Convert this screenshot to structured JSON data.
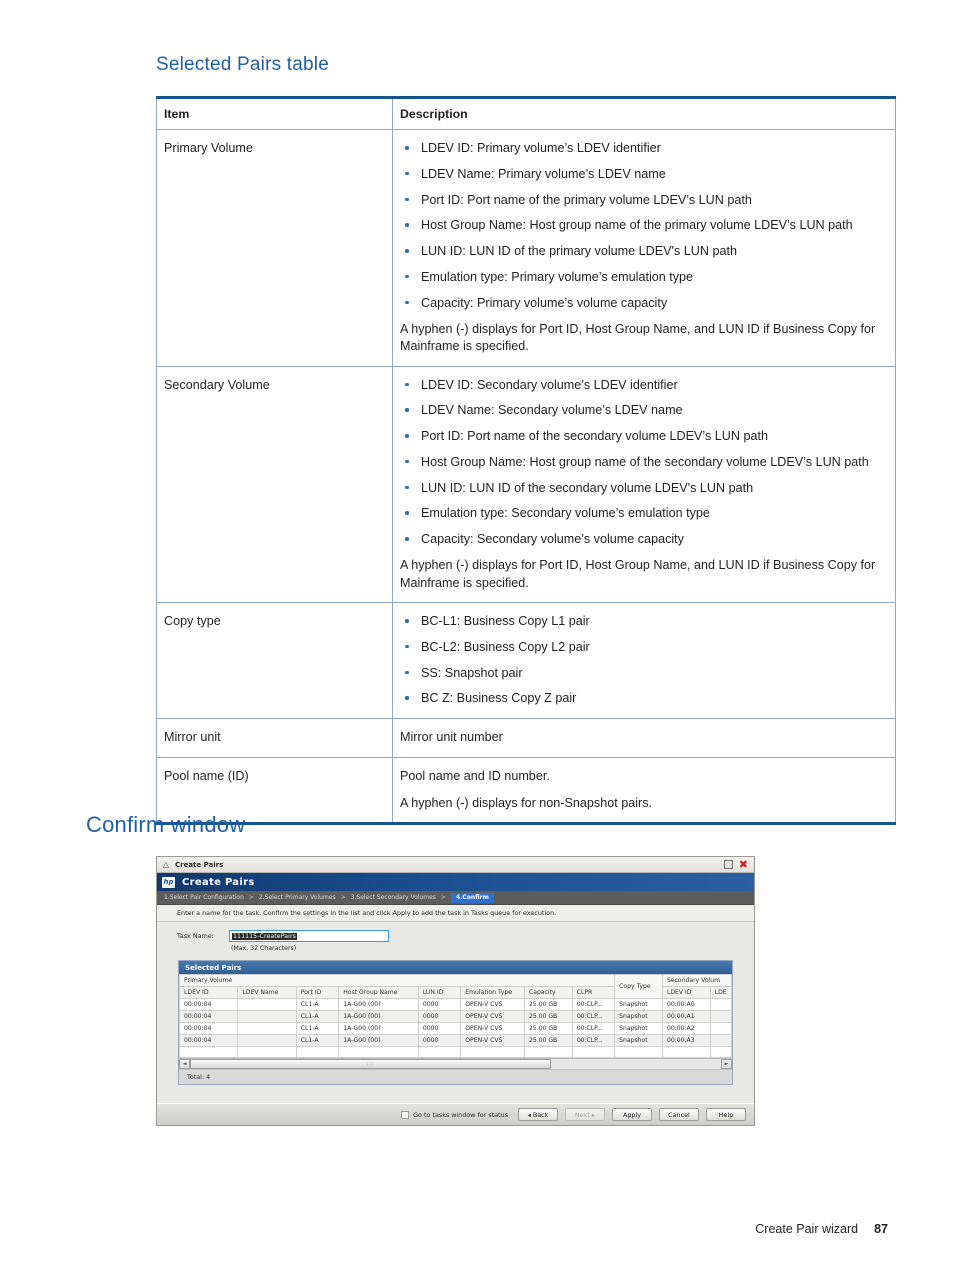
{
  "sections": {
    "selected_pairs_table_heading": "Selected Pairs table",
    "confirm_window_heading": "Confirm window"
  },
  "doc_table": {
    "headers": {
      "item": "Item",
      "description": "Description"
    },
    "rows": [
      {
        "item": "Primary Volume",
        "bullets": [
          "LDEV ID: Primary volume’s LDEV identifier",
          "LDEV Name: Primary volume’s LDEV name",
          "Port ID: Port name of the primary volume LDEV’s LUN path",
          "Host Group Name: Host group name of the primary volume LDEV’s LUN path",
          "LUN ID: LUN ID of the primary volume LDEV's LUN path",
          "Emulation type: Primary volume’s emulation type",
          "Capacity: Primary volume’s volume capacity"
        ],
        "note": "A hyphen (-) displays for Port ID, Host Group Name, and LUN ID if Business Copy for Mainframe is specified."
      },
      {
        "item": "Secondary Volume",
        "bullets": [
          "LDEV ID: Secondary volume’s LDEV identifier",
          "LDEV Name: Secondary volume’s LDEV name",
          "Port ID: Port name of the secondary volume LDEV’s LUN path",
          "Host Group Name: Host group name of the secondary volume LDEV’s LUN path",
          "LUN ID: LUN ID of the secondary volume LDEV's LUN path",
          "Emulation type: Secondary volume’s emulation type",
          "Capacity: Secondary volume’s volume capacity"
        ],
        "note": "A hyphen (-) displays for Port ID, Host Group Name, and LUN ID if Business Copy for Mainframe is specified."
      },
      {
        "item": "Copy type",
        "bullets": [
          "BC-L1: Business Copy L1 pair",
          "BC-L2: Business Copy L2 pair",
          "SS: Snapshot pair",
          "BC Z: Business Copy Z pair"
        ],
        "note": ""
      },
      {
        "item": "Mirror unit",
        "bullets": [],
        "paras": [
          "Mirror unit number"
        ]
      },
      {
        "item": "Pool name (ID)",
        "bullets": [],
        "paras": [
          "Pool name and ID number.",
          "A hyphen (-) displays for non-Snapshot pairs."
        ]
      }
    ]
  },
  "app": {
    "window_title": "Create Pairs",
    "window_icon": "collapse-chevron-icon",
    "maximize_icon": "maximize-icon",
    "close_icon": "close-icon",
    "brand_logo": "hp",
    "app_title": "Create Pairs",
    "wizard_steps": [
      {
        "label": "1.Select Pair Configuration",
        "active": false
      },
      {
        "label": "2.Select Primary Volumes",
        "active": false
      },
      {
        "label": "3.Select Secondary Volumes",
        "active": false
      },
      {
        "label": "4.Confirm",
        "active": true
      }
    ],
    "wizard_separator": ">",
    "instruction": "Enter a name for the task. Confirm the settings in the list and click Apply to add the task in Tasks queue for execution.",
    "task_name_label": "Task Name:",
    "task_name_value": "111115-CreatePairs",
    "task_name_hint": "(Max. 32 Characters)",
    "panel_title": "Selected Pairs",
    "group_headers": {
      "primary": "Primary Volume",
      "copy_type": "Copy Type",
      "secondary": "Secondary Volum"
    },
    "columns": [
      "LDEV ID",
      "LDEV Name",
      "Port ID",
      "Host Group Name",
      "LUN ID",
      "Emulation Type",
      "Capacity",
      "CLPR",
      "LDEV ID",
      "LDE"
    ],
    "rows": [
      {
        "ldev_id": "00:00:04",
        "ldev_name": "",
        "port_id": "CL1-A",
        "host_group_name": "1A-G00 (00)",
        "lun_id": "0000",
        "emulation_type": "OPEN-V CVS",
        "capacity": "25.00 GB",
        "clpr": "00:CLP...",
        "copy_type": "Snapshot",
        "sec_ldev_id": "00:00:A0",
        "sec_ldev_name": ""
      },
      {
        "ldev_id": "00:00:04",
        "ldev_name": "",
        "port_id": "CL1-A",
        "host_group_name": "1A-G00 (00)",
        "lun_id": "0000",
        "emulation_type": "OPEN-V CVS",
        "capacity": "25.00 GB",
        "clpr": "00:CLP...",
        "copy_type": "Snapshot",
        "sec_ldev_id": "00:00:A1",
        "sec_ldev_name": ""
      },
      {
        "ldev_id": "00:00:04",
        "ldev_name": "",
        "port_id": "CL1-A",
        "host_group_name": "1A-G00 (00)",
        "lun_id": "0000",
        "emulation_type": "OPEN-V CVS",
        "capacity": "25.00 GB",
        "clpr": "00:CLP...",
        "copy_type": "Snapshot",
        "sec_ldev_id": "00:00:A2",
        "sec_ldev_name": ""
      },
      {
        "ldev_id": "00:00:04",
        "ldev_name": "",
        "port_id": "CL1-A",
        "host_group_name": "1A-G00 (00)",
        "lun_id": "0000",
        "emulation_type": "OPEN-V CVS",
        "capacity": "25.00 GB",
        "clpr": "00:CLP...",
        "copy_type": "Snapshot",
        "sec_ldev_id": "00:00:A3",
        "sec_ldev_name": ""
      }
    ],
    "total_label": "Total:  4",
    "scroll_left_icon": "◄",
    "scroll_right_icon": "►",
    "footer": {
      "checkbox_label": "Go to tasks window for status",
      "back_label": "◂ Back",
      "next_label": "Next ▸",
      "apply_label": "Apply",
      "cancel_label": "Cancel",
      "help_label": "Help"
    }
  },
  "page_footer": {
    "chapter": "Create Pair wizard",
    "page_number": "87"
  },
  "colors": {
    "heading_blue": "#1f5fa9",
    "table_border_blue": "#17558f",
    "bullet_blue": "#2e6fb0",
    "wizard_active_blue": "#2f6fd0",
    "app_header_blue": "#1b4e8f",
    "close_red": "#cc2026"
  }
}
